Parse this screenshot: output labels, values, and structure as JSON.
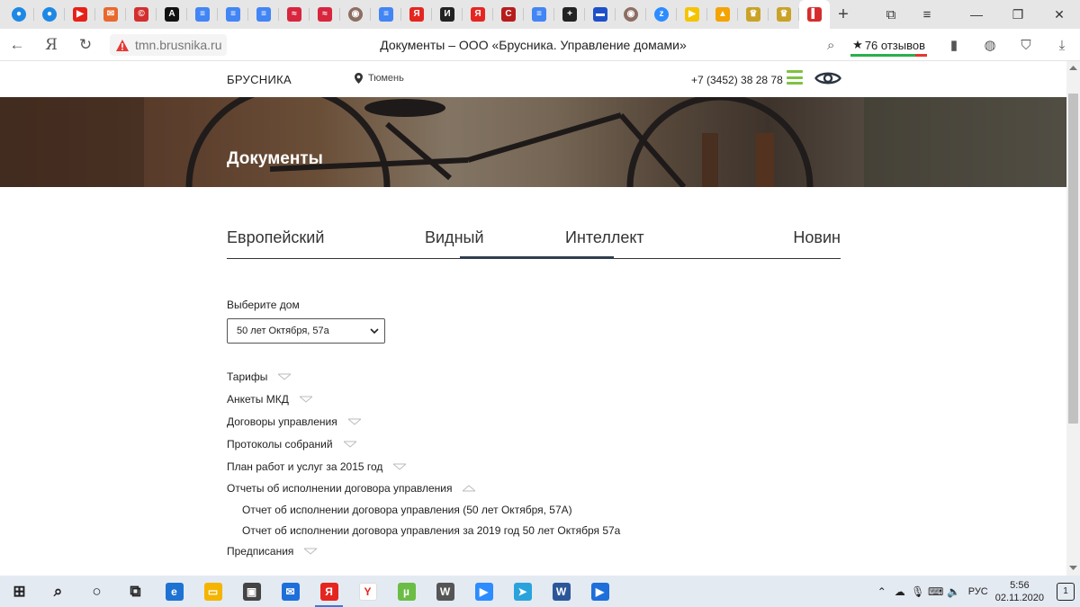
{
  "browser": {
    "tabs": [
      {
        "icon": "chat-bubble-icon",
        "color": "#1e88e5",
        "glyph": "●"
      },
      {
        "icon": "chat-bubble-icon",
        "color": "#1e88e5",
        "glyph": "●"
      },
      {
        "icon": "youtube-icon",
        "color": "#e62117",
        "glyph": "▶"
      },
      {
        "icon": "mail-icon",
        "color": "#e8692e",
        "glyph": "✉"
      },
      {
        "icon": "copyright-icon",
        "color": "#d32f2f",
        "glyph": "©"
      },
      {
        "icon": "letter-a-icon",
        "color": "#111111",
        "glyph": "A"
      },
      {
        "icon": "google-docs-icon",
        "color": "#4285f4",
        "glyph": "≡"
      },
      {
        "icon": "google-docs-icon",
        "color": "#4285f4",
        "glyph": "≡"
      },
      {
        "icon": "google-docs-icon",
        "color": "#4285f4",
        "glyph": "≡"
      },
      {
        "icon": "flag-icon",
        "color": "#d7263d",
        "glyph": "≈"
      },
      {
        "icon": "flag-icon",
        "color": "#d7263d",
        "glyph": "≈"
      },
      {
        "icon": "portrait-icon",
        "color": "#8d6e63",
        "glyph": "◉"
      },
      {
        "icon": "google-docs-icon",
        "color": "#4285f4",
        "glyph": "≡"
      },
      {
        "icon": "yandex-icon",
        "color": "#e52620",
        "glyph": "Я"
      },
      {
        "icon": "letter-i-icon",
        "color": "#222222",
        "glyph": "И"
      },
      {
        "icon": "yandex-icon",
        "color": "#e52620",
        "glyph": "Я"
      },
      {
        "icon": "book-icon",
        "color": "#b71c1c",
        "glyph": "C"
      },
      {
        "icon": "google-docs-icon",
        "color": "#4285f4",
        "glyph": "≡"
      },
      {
        "icon": "plus-box-icon",
        "color": "#222222",
        "glyph": "+"
      },
      {
        "icon": "russia-flag-icon",
        "color": "#1e50c8",
        "glyph": "▬"
      },
      {
        "icon": "portrait-icon",
        "color": "#8d6e63",
        "glyph": "◉"
      },
      {
        "icon": "zoom-icon",
        "color": "#2d8cff",
        "glyph": "z"
      },
      {
        "icon": "play-icon",
        "color": "#f5c400",
        "glyph": "▶"
      },
      {
        "icon": "mountain-icon",
        "color": "#f4a300",
        "glyph": "▲"
      },
      {
        "icon": "emblem-icon",
        "color": "#c9a227",
        "glyph": "♛"
      },
      {
        "icon": "emblem-icon",
        "color": "#c9a227",
        "glyph": "♛"
      },
      {
        "icon": "brusnika-icon",
        "color": "#d62c2c",
        "glyph": "▌",
        "active": true
      }
    ],
    "url": "tmn.brusnika.ru",
    "title": "Документы – ООО «Брусника. Управление домами»",
    "reviews": "76 отзывов"
  },
  "site": {
    "logo": "БРУСНИКА",
    "city": "Тюмень",
    "phone": "+7 (3452) 38 28 78",
    "accent_color": "#7dc242",
    "hero_title": "Документы",
    "house_tabs": [
      "Европейский",
      "Видный",
      "Интеллект",
      "Новин"
    ],
    "active_tab": "Новин",
    "select_label": "Выберите дом",
    "select_value": "50 лет Октября, 57а",
    "documents": [
      {
        "label": "Тарифы",
        "expanded": false
      },
      {
        "label": "Анкеты МКД",
        "expanded": false
      },
      {
        "label": "Договоры управления",
        "expanded": false
      },
      {
        "label": "Протоколы собраний",
        "expanded": false
      },
      {
        "label": "План работ и услуг за 2015 год",
        "expanded": false
      },
      {
        "label": "Отчеты об исполнении договора управления",
        "expanded": true
      },
      {
        "label": "Предписания",
        "expanded": false
      }
    ],
    "reports": [
      "Отчет об исполнении договора управления (50 лет Октября, 57А)",
      "Отчет об исполнении договора управления за 2019 год 50 лет Октября 57а"
    ]
  },
  "taskbar": {
    "apps": [
      {
        "icon": "windows-start-icon"
      },
      {
        "icon": "search-icon"
      },
      {
        "icon": "cortana-icon"
      },
      {
        "icon": "task-view-icon"
      },
      {
        "icon": "edge-icon"
      },
      {
        "icon": "file-explorer-icon"
      },
      {
        "icon": "store-icon"
      },
      {
        "icon": "mail-icon"
      },
      {
        "icon": "yandex-browser-icon",
        "active": true
      },
      {
        "icon": "yandex-icon"
      },
      {
        "icon": "utorrent-icon"
      },
      {
        "icon": "wps-icon"
      },
      {
        "icon": "zoom-icon"
      },
      {
        "icon": "telegram-icon"
      },
      {
        "icon": "word-icon"
      },
      {
        "icon": "media-player-icon"
      }
    ],
    "lang": "РУС",
    "time": "5:56",
    "date": "02.11.2020",
    "notifications": "1"
  }
}
